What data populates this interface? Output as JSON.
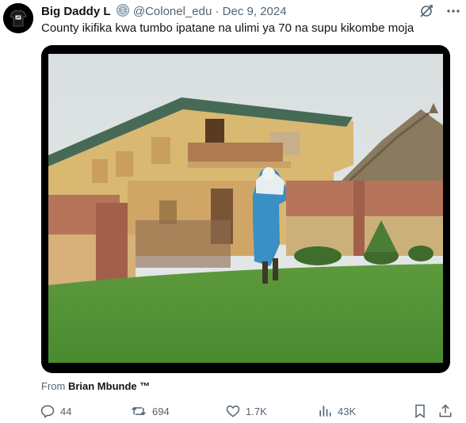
{
  "tweet": {
    "display_name": "Big Daddy L",
    "handle": "@Colonel_edu",
    "separator": "·",
    "date": "Dec 9, 2024",
    "text": "County ikifika kwa tumbo ipatane na ulimi ya 70 na supu kikombe moja"
  },
  "media": {
    "description_icon": "video-still"
  },
  "attribution": {
    "prefix": "From",
    "source": "Brian Mbunde ™"
  },
  "actions": {
    "replies": "44",
    "reposts": "694",
    "likes": "1.7K",
    "views": "43K"
  },
  "colors": {
    "text_primary": "#0f1419",
    "text_secondary": "#536471",
    "media_border": "#000000"
  }
}
